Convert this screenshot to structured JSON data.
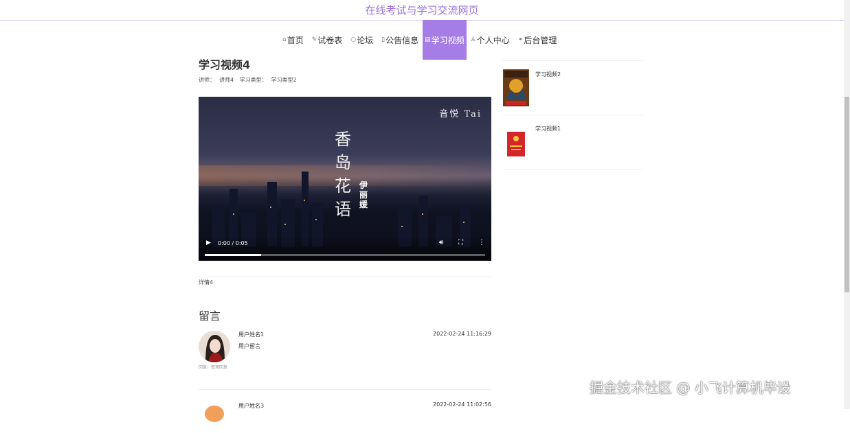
{
  "site": {
    "title": "在线考试与学习交流网页"
  },
  "nav": {
    "items": [
      {
        "icon": "home-icon",
        "glyph": "⌂",
        "label": "首页",
        "active": false
      },
      {
        "icon": "paper-icon",
        "glyph": "✎",
        "label": "试卷表",
        "active": false
      },
      {
        "icon": "forum-icon",
        "glyph": "○",
        "label": "论坛",
        "active": false
      },
      {
        "icon": "notice-icon",
        "glyph": "▯",
        "label": "公告信息",
        "active": false
      },
      {
        "icon": "video-icon",
        "glyph": "▤",
        "label": "学习视频",
        "active": true
      },
      {
        "icon": "user-icon",
        "glyph": "♙",
        "label": "个人中心",
        "active": false
      },
      {
        "icon": "link-icon",
        "glyph": "⚭",
        "label": "后台管理",
        "active": false
      }
    ],
    "active_color": "#a67de6"
  },
  "video": {
    "title": "学习视频4",
    "teacher_label": "讲师：",
    "teacher": "讲师4",
    "type_label": "学习类型：",
    "type": "学习类型2",
    "corner_text": "音悦 Tai",
    "poster_title": [
      "香",
      "岛",
      "花",
      "语"
    ],
    "singer": "伊丽媛",
    "time": "0:00 / 0:05",
    "progress": 0.2
  },
  "detail": {
    "text": "详情4"
  },
  "messages": {
    "title": "留言",
    "list": [
      {
        "user": "用户姓名1",
        "content": "用户留言",
        "time": "2022-02-24 11:16:29",
        "reply": "回复：管理回复"
      },
      {
        "user": "用户姓名3",
        "content": "",
        "time": "2022-02-24 11:02:56",
        "reply": ""
      }
    ]
  },
  "sidebar": {
    "items": [
      {
        "label": "学习视频2"
      },
      {
        "label": "学习视频1"
      }
    ]
  },
  "watermark": "掘金技术社区 @ 小飞计算机毕设"
}
